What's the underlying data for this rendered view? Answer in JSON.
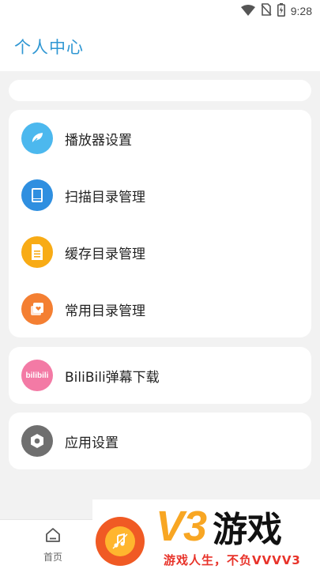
{
  "status_bar": {
    "time": "9:28",
    "icons": [
      "wifi-icon",
      "no-sim-icon",
      "battery-icon"
    ]
  },
  "header": {
    "title": "个人中心"
  },
  "menu": {
    "items": [
      {
        "label": "播放器设置",
        "icon": "player-settings-icon",
        "color": "#4cb8ee"
      },
      {
        "label": "扫描目录管理",
        "icon": "scan-directory-icon",
        "color": "#2f8fe0"
      },
      {
        "label": "缓存目录管理",
        "icon": "cache-directory-icon",
        "color": "#f8ab15"
      },
      {
        "label": "常用目录管理",
        "icon": "common-directory-icon",
        "color": "#f47f32"
      }
    ]
  },
  "bilibili": {
    "label": "BiliBili弹幕下载",
    "icon_text": "bilibili",
    "color": "#f37aa5"
  },
  "app_settings": {
    "label": "应用设置",
    "icon": "hexagon-settings-icon",
    "color": "#6f6f6f"
  },
  "bottom_nav": {
    "home_label": "首页",
    "accent": "#5cc0ee"
  },
  "watermark": {
    "brand": "V3",
    "name": "游戏",
    "slogan": "游戏人生，不负VVVV3"
  }
}
